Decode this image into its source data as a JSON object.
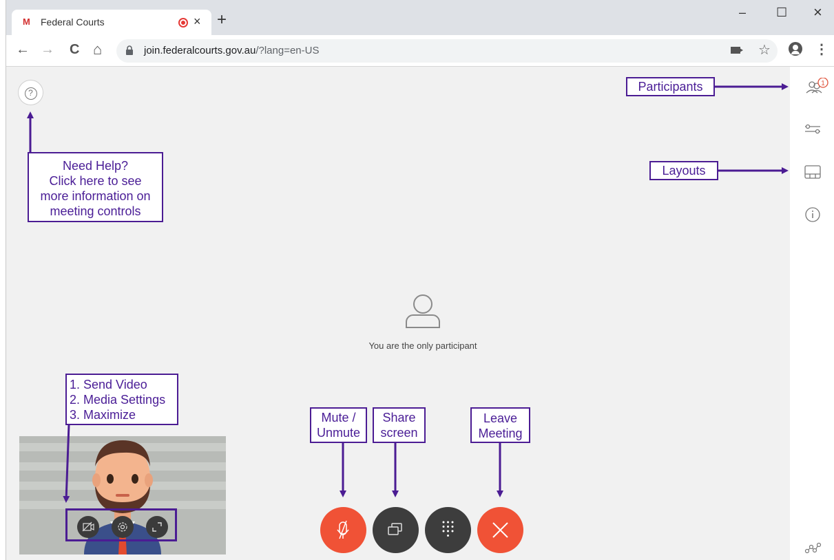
{
  "browser": {
    "tab_title": "Federal Courts",
    "favicon_text": "M",
    "close_tab": "×",
    "new_tab": "+",
    "url_host": "join.federalcourts.gov.au",
    "url_path": "/?lang=en-US",
    "window_controls": {
      "minimize": "–",
      "maximize": "☐",
      "close": "×"
    },
    "nav": {
      "back": "←",
      "forward": "→",
      "reload": "C",
      "home": "⌂"
    },
    "icons": [
      "lock-icon",
      "camera-icon",
      "star-icon",
      "profile-icon",
      "menu-icon"
    ]
  },
  "meeting": {
    "empty_message": "You are the only participant",
    "participants_count": "1",
    "help_glyph": "?",
    "sidebar_icons": [
      "participants-icon",
      "settings-sliders-icon",
      "layouts-icon",
      "info-icon",
      "stats-icon"
    ],
    "controls": [
      "mute-button",
      "share-screen-button",
      "dialpad-button",
      "leave-meeting-button"
    ],
    "video_controls": [
      "send-video-button",
      "media-settings-button",
      "maximize-button"
    ]
  },
  "annotations": {
    "help": [
      "Need Help?",
      "Click here to see",
      "more information on",
      "meeting controls"
    ],
    "participants": "Participants",
    "layouts": "Layouts",
    "video": [
      "1. Send Video",
      "2. Media Settings",
      "3. Maximize"
    ],
    "mute": [
      "Mute /",
      "Unmute"
    ],
    "share": [
      "Share",
      "screen"
    ],
    "leave": [
      "Leave",
      "Meeting"
    ]
  },
  "colors": {
    "annotation": "#4b1c93",
    "mute_red": "#f05236",
    "dark_control": "#3d3d3d",
    "background": "#f1f1f1"
  }
}
